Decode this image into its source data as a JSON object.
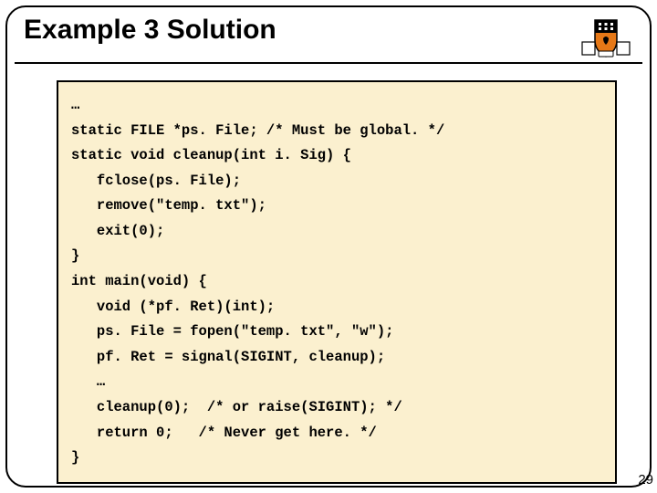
{
  "title": "Example 3 Solution",
  "page_number": "29",
  "code": {
    "l0": "…",
    "l1": "static FILE *ps. File; /* Must be global. */",
    "l2": "static void cleanup(int i. Sig) {",
    "l3": "   fclose(ps. File);",
    "l4": "   remove(\"temp. txt\");",
    "l5": "   exit(0);",
    "l6": "}",
    "l7": "int main(void) {",
    "l8": "   void (*pf. Ret)(int);",
    "l9": "   ps. File = fopen(\"temp. txt\", \"w\");",
    "l10": "   pf. Ret = signal(SIGINT, cleanup);",
    "l11": "   …",
    "l12": "   cleanup(0);  /* or raise(SIGINT); */",
    "l13": "   return 0;   /* Never get here. */",
    "l14": "}"
  }
}
